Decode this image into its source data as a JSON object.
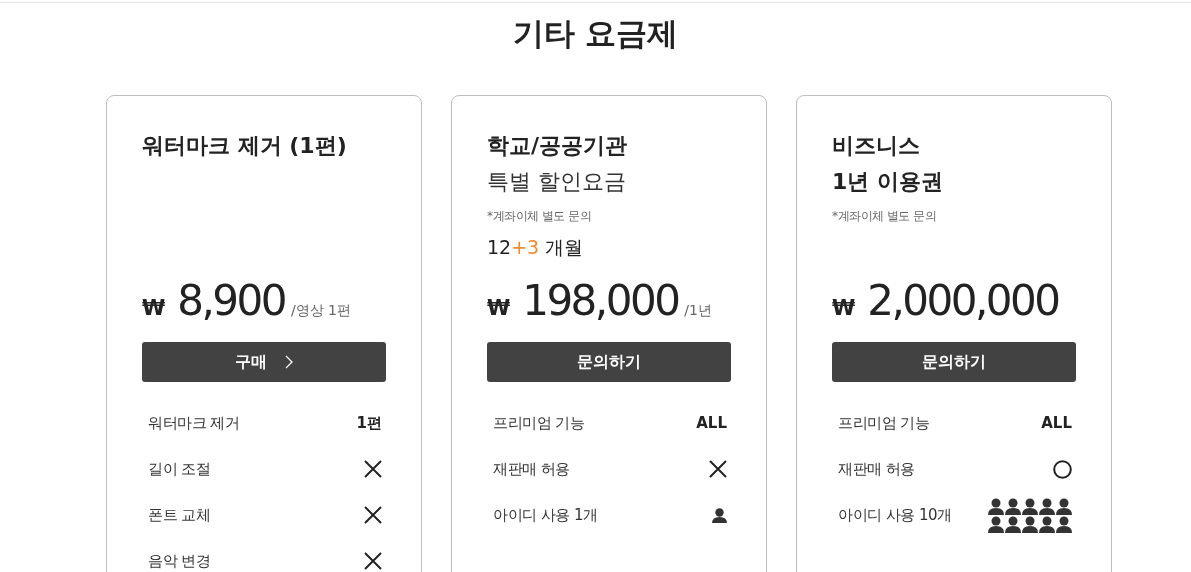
{
  "heading": "기타 요금제",
  "cards": [
    {
      "title_lines": [
        {
          "text": "워터마크 제거 (1편)",
          "kind": "bold"
        }
      ],
      "price": {
        "currency": "₩",
        "amount": "8,900",
        "unit": "/영상 1편"
      },
      "button": {
        "label": "구매",
        "arrow": true
      },
      "features": [
        {
          "name": "워터마크 제거",
          "kind": "text",
          "value": "1편"
        },
        {
          "name": "길이 조절",
          "kind": "cross"
        },
        {
          "name": "폰트 교체",
          "kind": "cross"
        },
        {
          "name": "음악 변경",
          "kind": "cross"
        }
      ]
    },
    {
      "title_lines": [
        {
          "text": "학교/공공기관",
          "kind": "bold"
        },
        {
          "text": "특별 할인요금",
          "kind": "regular"
        }
      ],
      "note": "*계좌이체 별도 문의",
      "period": {
        "base": "12",
        "bonus": "+3",
        "unit": "개월"
      },
      "price": {
        "currency": "₩",
        "amount": "198,000",
        "unit": "/1년"
      },
      "button": {
        "label": "문의하기",
        "arrow": false
      },
      "features": [
        {
          "name": "프리미엄 기능",
          "kind": "text",
          "value": "ALL"
        },
        {
          "name": "재판매 허용",
          "kind": "cross"
        },
        {
          "name": "아이디 사용 1개",
          "kind": "person"
        }
      ]
    },
    {
      "title_lines": [
        {
          "text": "비즈니스",
          "kind": "bold"
        },
        {
          "text": "1년 이용권",
          "kind": "bold"
        }
      ],
      "note": "*계좌이체 별도 문의",
      "price": {
        "currency": "₩",
        "amount": "2,000,000"
      },
      "button": {
        "label": "문의하기",
        "arrow": false
      },
      "features": [
        {
          "name": "프리미엄 기능",
          "kind": "text",
          "value": "ALL"
        },
        {
          "name": "재판매 허용",
          "kind": "circle"
        },
        {
          "name": "아이디 사용 10개",
          "kind": "people"
        }
      ]
    }
  ]
}
